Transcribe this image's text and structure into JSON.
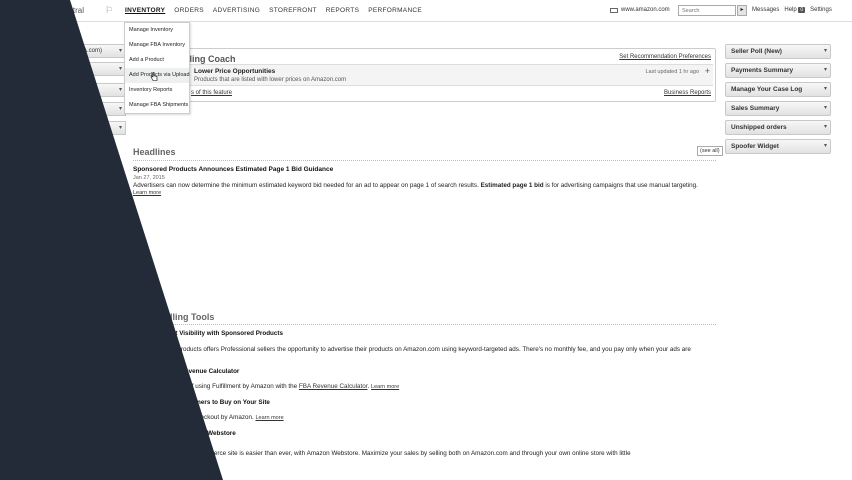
{
  "nav": {
    "brand": "central",
    "links": [
      "INVENTORY",
      "ORDERS",
      "ADVERTISING",
      "STOREFRONT",
      "REPORTS",
      "PERFORMANCE"
    ],
    "site": "www.amazon.com",
    "search_placeholder": "Search",
    "search_button": "▸",
    "messages": "Messages",
    "messages_count": "0",
    "help": "Help",
    "settings": "Settings"
  },
  "inventory_menu": [
    "Manage Inventory",
    "Manage FBA Inventory",
    "Add a Product",
    "Add Products via Upload",
    "Inventory Reports",
    "Manage FBA Shipments"
  ],
  "sidebar": {
    "marketplace_label": "A.com)"
  },
  "coach": {
    "title": "lling Coach",
    "prefs": "Set Recommendation Preferences",
    "row_title": "Lower Price Opportunities",
    "row_sub": "Products that are listed with lower prices on Amazon.com",
    "updated": "Last updated 1 hr ago",
    "feature_link": "s of this feature",
    "reports_link": "Business Reports"
  },
  "headlines": {
    "title": "Headlines",
    "see_all": "(see all)",
    "item_title": "Sponsored Products Announces Estimated Page 1 Bid Guidance",
    "item_date": "Jan 27, 2015",
    "item_text_1": "Advertisers can now determine the minimum estimated keyword bid needed for an ad to appear on page 1 of search results.",
    "item_text_bold": "Estimated page 1 bid",
    "item_text_2": "is for advertising campaigns that use manual targeting.",
    "item_more": "Learn more"
  },
  "tools": {
    "title": "lling Tools",
    "items": [
      {
        "heading": "uct Visibility with Sponsored Products",
        "text": "ed Products offers Professional sellers the opportunity to advertise their products on Amazon.com using keyword-targeted ads. There's no monthly fee, and you pay only when your ads are",
        "more": ""
      },
      {
        "heading": "zon Revenue Calculator",
        "text": "enefits of using Fulfillment by Amazon with the",
        "link": "FBA Revenue Calculator",
        "more": "Learn more"
      },
      {
        "heading": "on Customers to Buy on Your Site",
        "text": "site with Checkout by Amazon.",
        "more": "Learn more"
      },
      {
        "heading": "zed site with Webstore",
        "text": "tomized eCommerce site is easier than ever, with Amazon Webstore. Maximize your sales by selling both on Amazon.com and through your own online store with little",
        "more": ""
      }
    ]
  },
  "widgets": [
    "Seller Poll (New)",
    "Payments Summary",
    "Manage Your Case Log",
    "Sales Summary",
    "Unshipped orders",
    "Spoofer Widget"
  ],
  "colors": {
    "overlay": "#222b37",
    "nav_text": "#333333"
  }
}
